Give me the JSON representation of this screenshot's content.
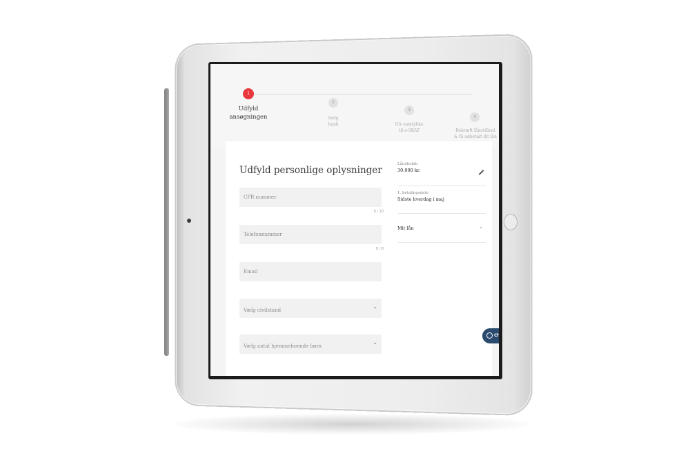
{
  "stepper": {
    "steps": [
      {
        "number": "1",
        "label_line1": "Udfyld",
        "label_line2": "ansøgningen",
        "active": true
      },
      {
        "number": "2",
        "label_line1": "Vælg",
        "label_line2": "bank",
        "active": false
      },
      {
        "number": "3",
        "label_line1": "Giv samtykke",
        "label_line2": "til e-SKAT",
        "active": false
      },
      {
        "number": "4",
        "label_line1": "Bekræft lånetilbud",
        "label_line2": "& få udbetalt dit lån",
        "active": false
      }
    ]
  },
  "form": {
    "title": "Udfyld personlige oplysninger",
    "cpr": {
      "placeholder": "CPR nummer",
      "counter": "0 / 10"
    },
    "phone": {
      "placeholder": "Telefonnummer",
      "counter": "0 / 8"
    },
    "email": {
      "placeholder": "Email"
    },
    "civil_status": {
      "placeholder": "Vælg civilstand"
    },
    "children": {
      "placeholder": "Vælg antal hjemmeboende børn"
    }
  },
  "summary": {
    "loan_amount": {
      "label": "Lånebeløb",
      "value": "30.000 kr."
    },
    "first_payment": {
      "label": "1. betalingsdato",
      "value": "Sidste hverdag i maj"
    },
    "my_loan": {
      "label": "Mit lån"
    }
  },
  "chat": {
    "label": "Ch"
  },
  "colors": {
    "accent": "#e8373e",
    "chat": "#2a4a6e"
  }
}
